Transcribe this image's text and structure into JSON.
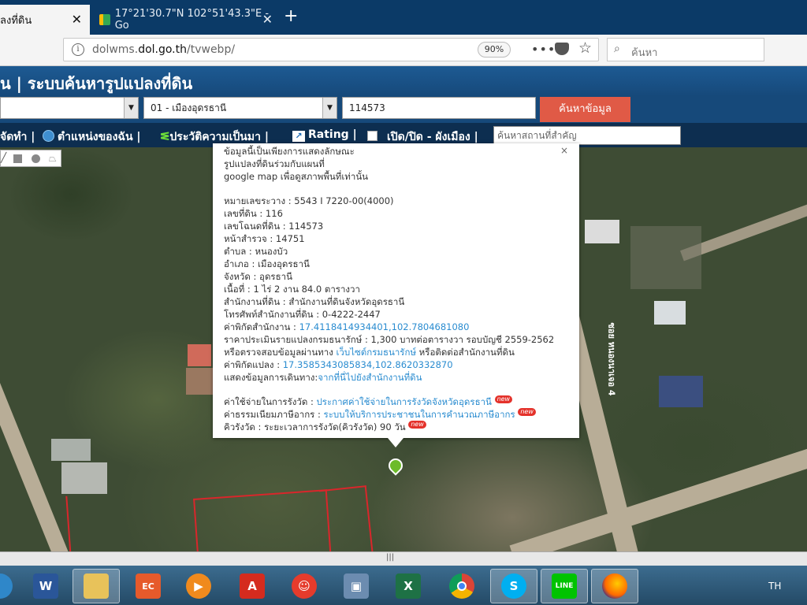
{
  "browser": {
    "tab1_label": "ลงที่ดิน",
    "tab2_label": "17°21'30.7\"N 102°51'43.3\"E - Go",
    "url_prefix": "dolwms.",
    "url_domain": "dol.go.th",
    "url_path": "/tvwebp/",
    "zoom": "90%",
    "search_placeholder": "ค้นหา"
  },
  "app": {
    "title": "น | ระบบค้นหารูปแปลงที่ดิน",
    "district_select": "01 - เมืองอุดรธานี",
    "deed_number": "114573",
    "search_button": "ค้นหาข้อมูล",
    "toolbar": {
      "item1": "จัดทำ",
      "item2": "ตำแหน่งของฉัน",
      "item3": "ประวัติความเป็นมา",
      "item4": "Rating",
      "item5": "เปิด/ปิด - ผังเมือง",
      "place_placeholder": "ค้นหาสถานที่สำคัญ"
    },
    "road_label": "ซอย หนองนาเจอ 4"
  },
  "popup": {
    "note1": "ข้อมูลนี้เป็นเพียงการแสดงลักษณะ",
    "note2": "รูปแปลงที่ดินร่วมกับแผนที่",
    "note3": "google map เพื่อดูสภาพพื้นที่เท่านั้น",
    "survey_no": "หมายเลขระวาง : 5543 I 7220-00(4000)",
    "land_no": "เลขที่ดิน : 116",
    "deed_no": "เลขโฉนดที่ดิน : 114573",
    "survey_page": "หน้าสำรวจ : 14751",
    "subdistrict": "ตำบล : หนองบัว",
    "district": "อำเภอ : เมืองอุดรธานี",
    "province": "จังหวัด : อุดรธานี",
    "area": "เนื้อที่ : 1 ไร่ 2 งาน 84.0 ตารางวา",
    "office": "สำนักงานที่ดิน : สำนักงานที่ดินจังหวัดอุดรธานี",
    "phone": "โทรศัพท์สำนักงานที่ดิน : 0-4222-2447",
    "office_coord_label": "ค่าพิกัดสำนักงาน : ",
    "office_coord": "17.4118414934401,102.7804681080",
    "price": "ราคาประเมินรายแปลงกรมธนารักษ์ : 1,300 บาทต่อตารางวา รอบบัญชี 2559-2562",
    "check_prefix": "หรือตรวจสอบข้อมูลผ่านทาง ",
    "check_link": "เว็บไซต์กรมธนารักษ์",
    "check_suffix": " หรือติดต่อสำนักงานที่ดิน",
    "parcel_coord_label": "ค่าพิกัดแปลง : ",
    "parcel_coord": "17.3585343085834,102.8620332870",
    "route_prefix": "แสดงข้อมูลการเดินทาง:",
    "route_link": "จากที่นี่ไปยังสำนักงานที่ดิน",
    "fee_label": "ค่าใช้จ่ายในการรังวัด : ",
    "fee_link": "ประกาศค่าใช้จ่ายในการรังวัดจังหวัดอุดรธานี",
    "tax_label": "ค่าธรรมเนียมภาษีอากร : ",
    "tax_link": "ระบบให้บริการประชาชนในการคำนวณภาษีอากร",
    "queue_label": "คิวรังวัด : ",
    "queue_value": "ระยะเวลาการรังวัด(คิวรังวัด) 90 วัน",
    "new_badge": "new",
    "close": "×"
  },
  "taskbar": {
    "lang": "TH"
  }
}
